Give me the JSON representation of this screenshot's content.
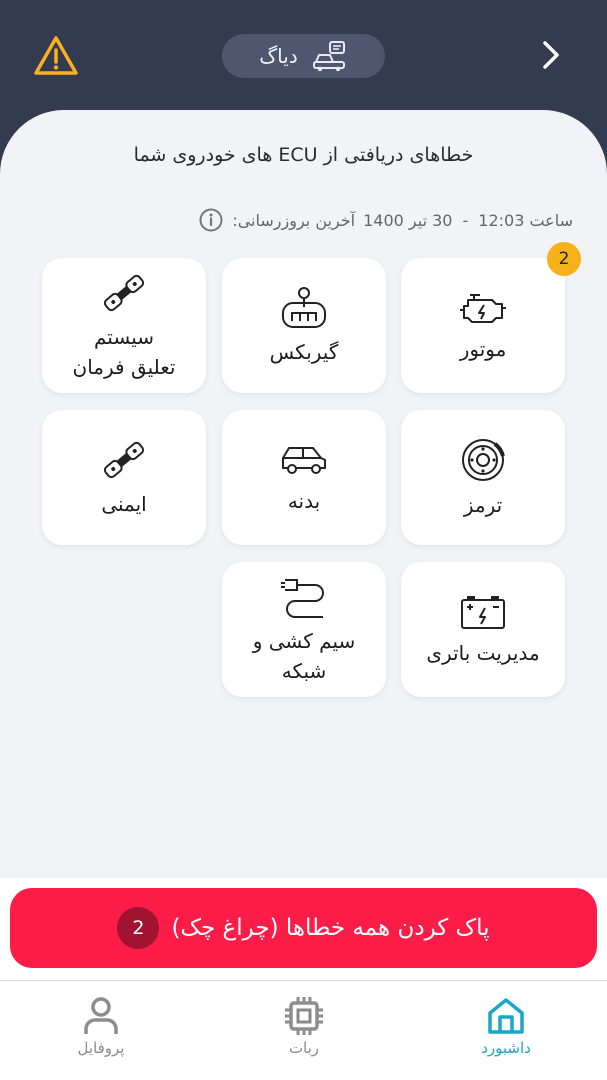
{
  "header": {
    "title": "دیاگ",
    "colors": {
      "background": "#343a4f",
      "pill": "#4e5670",
      "warning": "#f7b21b"
    }
  },
  "content": {
    "heading": "خطاهای دریافتی از ECU های خودروی شما",
    "last_update_label": "آخرین بروزرسانی:",
    "last_update_date": "30 تیر 1400",
    "last_update_separator": "-",
    "last_update_time": "ساعت 12:03"
  },
  "categories": [
    {
      "label": "موتور",
      "icon": "engine-icon",
      "badge": "2"
    },
    {
      "label": "گیربکس",
      "icon": "gearbox-icon"
    },
    {
      "label": "سیستم\nتعلیق فرمان",
      "icon": "suspension-icon"
    },
    {
      "label": "ترمز",
      "icon": "brake-disc-icon"
    },
    {
      "label": "بدنه",
      "icon": "car-body-icon"
    },
    {
      "label": "ایمنی",
      "icon": "seatbelt-icon"
    },
    {
      "label": "مدیریت باتری",
      "icon": "battery-icon"
    },
    {
      "label": "سیم کشی و\nشبکه",
      "icon": "wiring-plug-icon"
    }
  ],
  "clear_button": {
    "label": "پاک کردن همه خطاها (چراغ چک)",
    "count": "2",
    "color": "#fb1d48"
  },
  "nav": [
    {
      "label": "داشبورد",
      "icon": "home-icon",
      "active": true
    },
    {
      "label": "ربات",
      "icon": "chip-icon"
    },
    {
      "label": "پروفایل",
      "icon": "user-icon"
    }
  ],
  "accent": "#18a7c6"
}
